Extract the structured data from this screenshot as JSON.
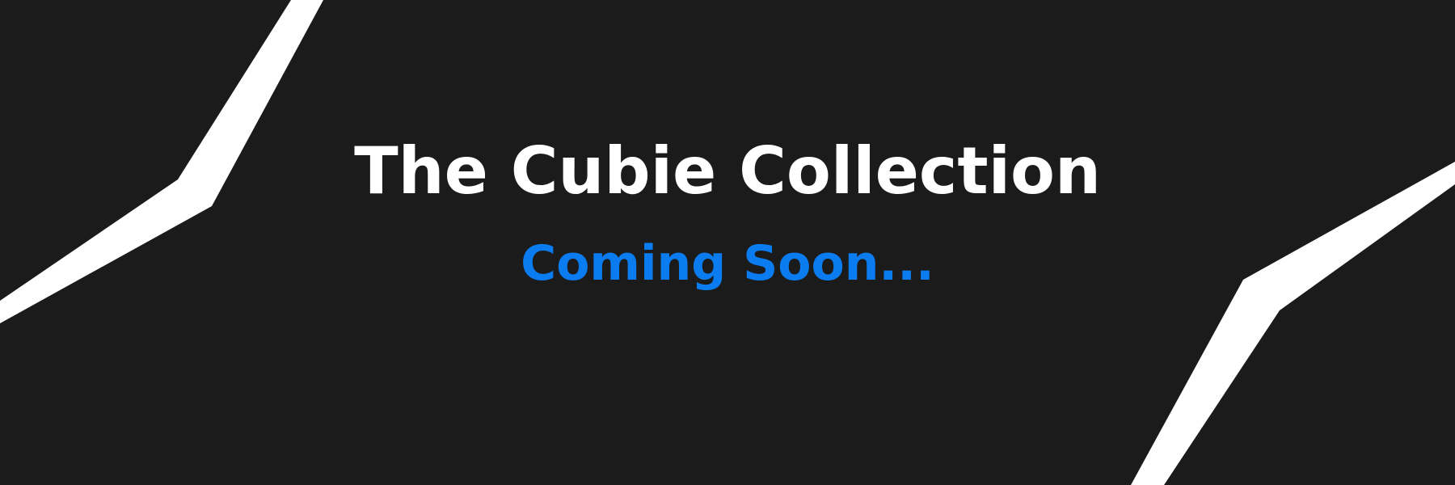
{
  "banner": {
    "title": "The Cubie Collection",
    "subtitle": "Coming Soon..."
  },
  "colors": {
    "background": "#1b1b1b",
    "title": "#ffffff",
    "subtitle": "#0a7cf0",
    "decor": "#ffffff"
  },
  "decor": {
    "left_shape": "white angled stripe",
    "right_shape": "white angled stripe"
  }
}
